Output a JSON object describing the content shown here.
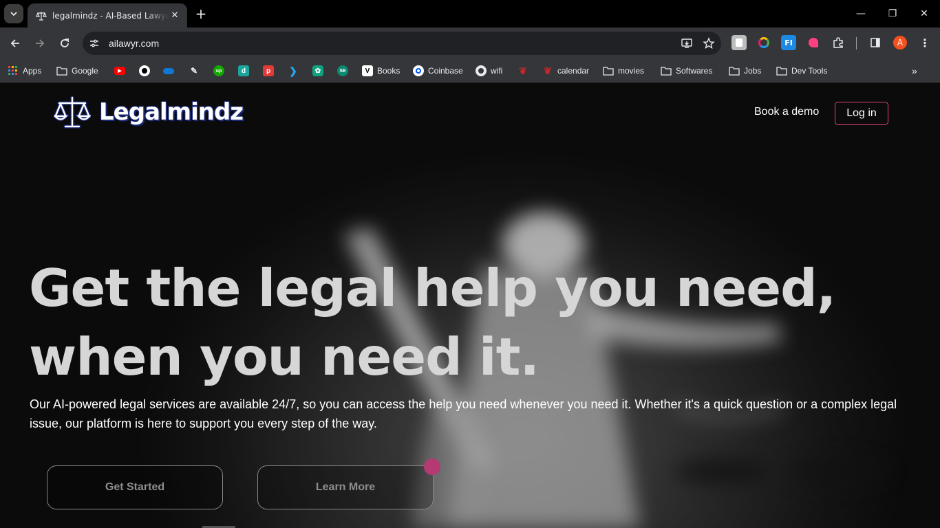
{
  "browser": {
    "tab": {
      "title": "legalmindz - AI-Based Lawyer Se",
      "close": "✕"
    },
    "new_tab": "+",
    "window": {
      "minimize": "—",
      "restore": "❐",
      "close": "✕"
    },
    "url": "ailawyr.com"
  },
  "bookmarks": [
    {
      "label": "Apps",
      "icon": "apps-grid-icon"
    },
    {
      "label": "Google",
      "icon": "folder-icon"
    },
    {
      "label": "",
      "icon": "youtube-icon"
    },
    {
      "label": "",
      "icon": "github-icon"
    },
    {
      "label": "",
      "icon": "onedrive-icon"
    },
    {
      "label": "",
      "icon": "pen-icon"
    },
    {
      "label": "",
      "icon": "upwork-icon"
    },
    {
      "label": "",
      "icon": "d-icon"
    },
    {
      "label": "",
      "icon": "p-icon"
    },
    {
      "label": "",
      "icon": "vscode-icon"
    },
    {
      "label": "",
      "icon": "chatgpt-icon"
    },
    {
      "label": "",
      "icon": "globe-icon"
    },
    {
      "label": "Books",
      "icon": "v-icon"
    },
    {
      "label": "Coinbase",
      "icon": "coinbase-icon"
    },
    {
      "label": "wifi",
      "icon": "globe-icon"
    },
    {
      "label": "",
      "icon": "red-swirl-icon"
    },
    {
      "label": "calendar",
      "icon": "red-swirl-icon"
    },
    {
      "label": "movies",
      "icon": "folder-icon"
    },
    {
      "label": "Softwares",
      "icon": "folder-icon"
    },
    {
      "label": "Jobs",
      "icon": "folder-icon"
    },
    {
      "label": "Dev Tools",
      "icon": "folder-icon"
    }
  ],
  "profile": {
    "initial": "A",
    "color": "#f4511e"
  },
  "site": {
    "logo_text": "Legalmindz",
    "nav": {
      "book_demo": "Book a demo",
      "login": "Log in"
    },
    "hero": {
      "title_line1": "Get the legal help you need,",
      "title_line2": "when you need it.",
      "subtitle": "Our AI-powered legal services are available 24/7, so you can access the help you need whenever you need it. Whether it's a quick question or a complex legal issue, our platform is here to support you every step of the way.",
      "cta_primary": "Get Started",
      "cta_secondary": "Learn More"
    },
    "colors": {
      "accent": "#e0457b",
      "dot": "#b53a73",
      "logo_outline": "#1b2a7a"
    }
  }
}
